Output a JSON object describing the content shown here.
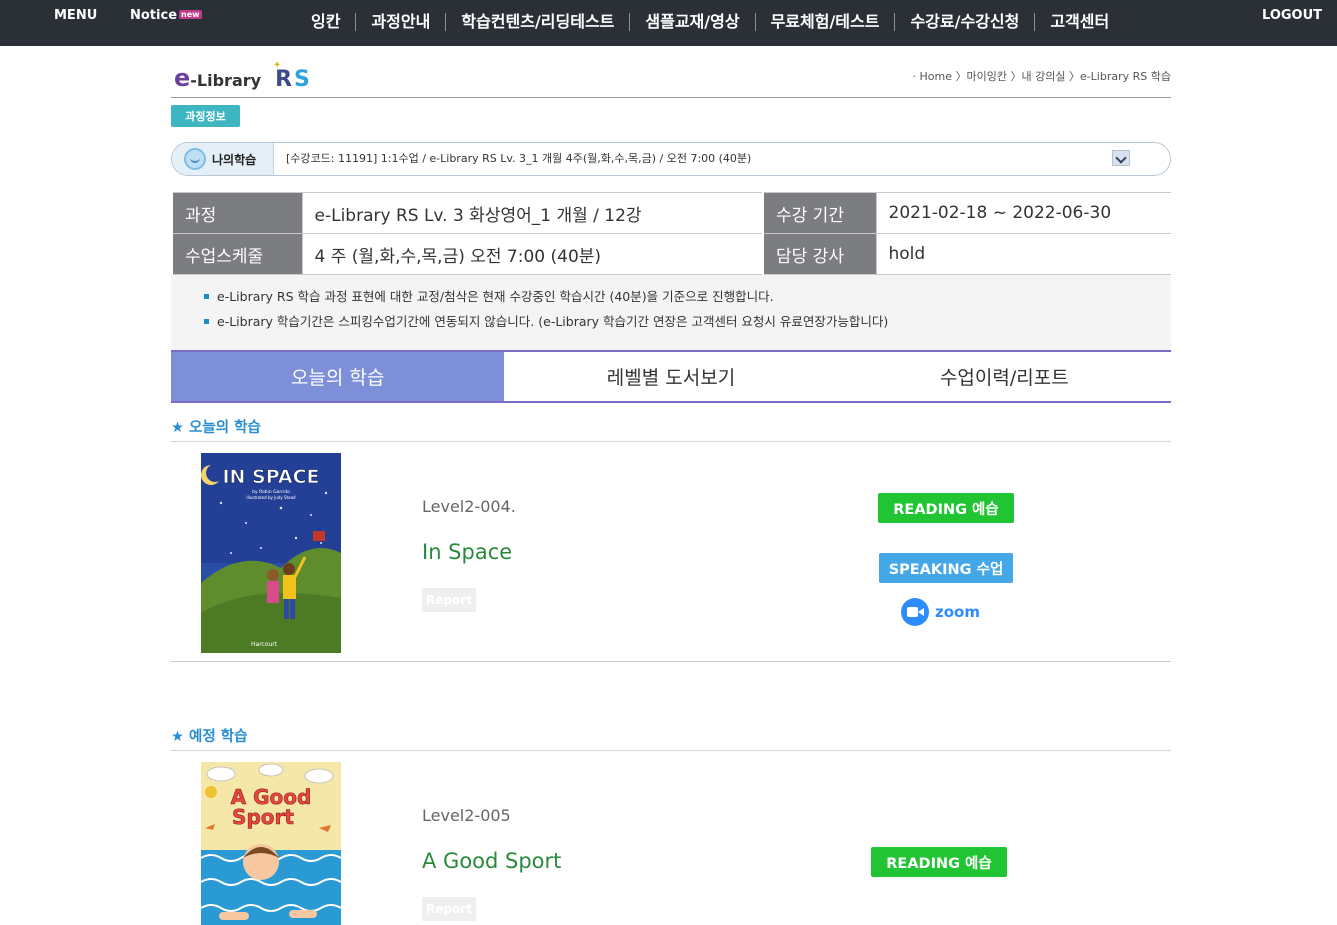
{
  "topnav": {
    "menu": "MENU",
    "notice": "Notice",
    "notice_badge": "new",
    "logout": "LOGOUT",
    "items": [
      "잉칸",
      "과정안내",
      "학습컨텐츠/리딩테스트",
      "샘플교재/영상",
      "무료체험/테스트",
      "수강료/수강신청",
      "고객센터"
    ]
  },
  "logo": {
    "e": "e",
    "lib": "-Library",
    "rs_r": "R",
    "rs_s": "S"
  },
  "breadcrumb": "· Home 〉마이잉칸 〉내 강의실 〉e-Library RS 학습",
  "course_info_tab": "과정정보",
  "my_study": {
    "label": "나의학습",
    "selected": "[수강코드: 11191] 1:1수업 / e-Library RS Lv. 3_1 개월 4주(월,화,수,목,금) / 오전 7:00 (40분)"
  },
  "info": {
    "course_label": "과정",
    "course_value": "e-Library RS Lv. 3 화상영어_1 개월 / 12강",
    "period_label": "수강 기간",
    "period_value": "2021-02-18 ~ 2022-06-30",
    "schedule_label": "수업스케줄",
    "schedule_value": "4 주 (월,화,수,목,금) 오전 7:00 (40분)",
    "teacher_label": "담당 강사",
    "teacher_value": "hold"
  },
  "notes": [
    "e-Library RS 학습 과정 표현에 대한 교정/첨삭은 현재 수강중인 학습시간 (40분)을 기준으로 진행합니다.",
    "e-Library 학습기간은 스피킹수업기간에 연동되지 않습니다. (e-Library 학습기간 연장은 고객센터 요청시 유료연장가능합니다)"
  ],
  "tabs": [
    "오늘의 학습",
    "레벨별 도서보기",
    "수업이력/리포트"
  ],
  "today": {
    "section_title": "★ 오늘의 학습",
    "level": "Level2-004.",
    "title": "In Space",
    "report": "Report",
    "reading_btn": "READING 예습",
    "speaking_btn": "SPEAKING 수업",
    "zoom": "zoom",
    "cover_title": "IN SPACE",
    "cover_author": "by Robin Garrido",
    "cover_illus": "Illustrated by Judy Stead",
    "cover_publisher": "Harcourt"
  },
  "upcoming": {
    "section_title": "★ 예정 학습",
    "level": "Level2-005",
    "title": "A Good Sport",
    "report": "Report",
    "reading_btn": "READING 예습",
    "cover_title_1": "A Good",
    "cover_title_2": "Sport"
  },
  "colors": {
    "nav_bg": "#2b2f36",
    "active_tab": "#7c8fd8",
    "tab_border": "#7a6bc6",
    "green_btn": "#21c433",
    "blue_btn": "#44a8e8",
    "book_title": "#2a8a3c",
    "section_title": "#2a8fd0"
  }
}
